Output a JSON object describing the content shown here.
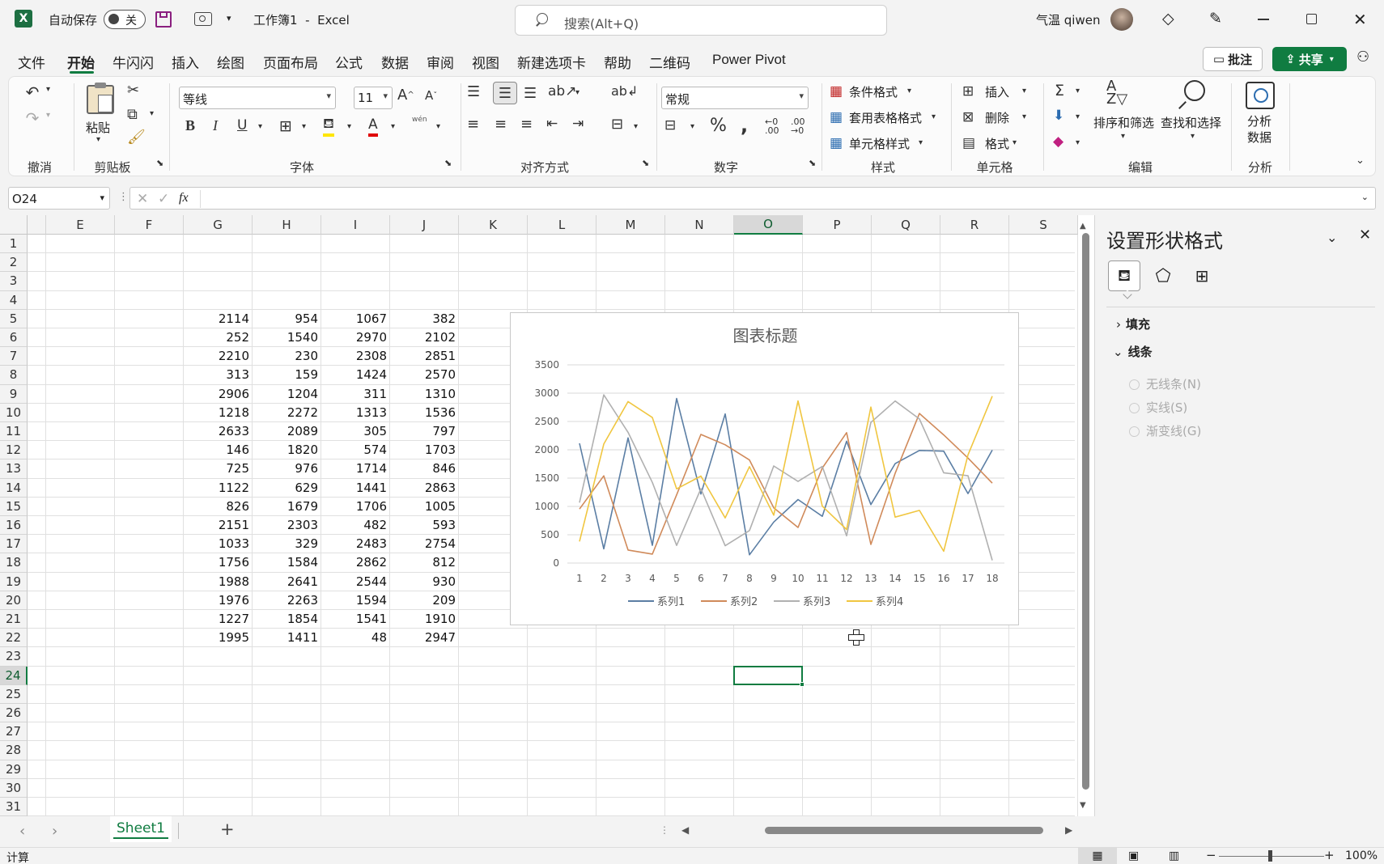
{
  "titlebar": {
    "app_icon": "excel-logo",
    "autosave_label": "自动保存",
    "autosave_state": "关",
    "doc_title": "工作簿1",
    "separator": "-",
    "app_name": "Excel",
    "search_placeholder": "搜索(Alt+Q)",
    "user_name": "气温 qiwen"
  },
  "menu": {
    "items": [
      "文件",
      "开始",
      "牛闪闪",
      "插入",
      "绘图",
      "页面布局",
      "公式",
      "数据",
      "审阅",
      "视图",
      "新建选项卡",
      "帮助",
      "二维码",
      "Power Pivot"
    ],
    "active": "开始",
    "comment_button": "批注",
    "share_button": "共享"
  },
  "ribbon": {
    "groups": [
      "撤消",
      "剪贴板",
      "字体",
      "对齐方式",
      "数字",
      "样式",
      "单元格",
      "编辑",
      "分析"
    ],
    "paste_label": "粘贴",
    "font_name": "等线",
    "font_size": "11",
    "number_format": "常规",
    "phonetic_label": "wén",
    "styles": [
      "条件格式",
      "套用表格格式",
      "单元格样式"
    ],
    "cells": [
      "插入",
      "删除",
      "格式"
    ],
    "sort_filter": "排序和筛选",
    "find_select": "查找和选择",
    "analyze_line1": "分析",
    "analyze_line2": "数据"
  },
  "formula_bar": {
    "name_box": "O24",
    "fx": "fx",
    "content": ""
  },
  "sheet": {
    "columns": [
      "E",
      "F",
      "G",
      "H",
      "I",
      "J",
      "K",
      "L",
      "M",
      "N",
      "O",
      "P",
      "Q",
      "R",
      "S"
    ],
    "active_column": "O",
    "rows": [
      "1",
      "2",
      "3",
      "4",
      "5",
      "6",
      "7",
      "8",
      "9",
      "10",
      "11",
      "12",
      "13",
      "14",
      "15",
      "16",
      "17",
      "18",
      "19",
      "20",
      "21",
      "22",
      "23",
      "24",
      "25",
      "26",
      "27",
      "28",
      "29",
      "30",
      "31"
    ],
    "active_row": "24",
    "data_start_row": 5,
    "data": [
      [
        "2114",
        "954",
        "1067",
        "382"
      ],
      [
        "252",
        "1540",
        "2970",
        "2102"
      ],
      [
        "2210",
        "230",
        "2308",
        "2851"
      ],
      [
        "313",
        "159",
        "1424",
        "2570"
      ],
      [
        "2906",
        "1204",
        "311",
        "1310"
      ],
      [
        "1218",
        "2272",
        "1313",
        "1536"
      ],
      [
        "2633",
        "2089",
        "305",
        "797"
      ],
      [
        "146",
        "1820",
        "574",
        "1703"
      ],
      [
        "725",
        "976",
        "1714",
        "846"
      ],
      [
        "1122",
        "629",
        "1441",
        "2863"
      ],
      [
        "826",
        "1679",
        "1706",
        "1005"
      ],
      [
        "2151",
        "2303",
        "482",
        "593"
      ],
      [
        "1033",
        "329",
        "2483",
        "2754"
      ],
      [
        "1756",
        "1584",
        "2862",
        "812"
      ],
      [
        "1988",
        "2641",
        "2544",
        "930"
      ],
      [
        "1976",
        "2263",
        "1594",
        "209"
      ],
      [
        "1227",
        "1854",
        "1541",
        "1910"
      ],
      [
        "1995",
        "1411",
        "48",
        "2947"
      ]
    ]
  },
  "chart_data": {
    "type": "line",
    "title": "图表标题",
    "x": [
      1,
      2,
      3,
      4,
      5,
      6,
      7,
      8,
      9,
      10,
      11,
      12,
      13,
      14,
      15,
      16,
      17,
      18
    ],
    "ylim": [
      0,
      3500
    ],
    "yticks": [
      0,
      500,
      1000,
      1500,
      2000,
      2500,
      3000,
      3500
    ],
    "grid": true,
    "legend": "bottom",
    "series": [
      {
        "name": "系列1",
        "color": "#5b7ea4",
        "values": [
          2114,
          252,
          2210,
          313,
          2906,
          1218,
          2633,
          146,
          725,
          1122,
          826,
          2151,
          1033,
          1756,
          1988,
          1976,
          1227,
          1995
        ]
      },
      {
        "name": "系列2",
        "color": "#d08a5a",
        "values": [
          954,
          1540,
          230,
          159,
          1204,
          2272,
          2089,
          1820,
          976,
          629,
          1679,
          2303,
          329,
          1584,
          2641,
          2263,
          1854,
          1411
        ]
      },
      {
        "name": "系列3",
        "color": "#b0b0b0",
        "values": [
          1067,
          2970,
          2308,
          1424,
          311,
          1313,
          305,
          574,
          1714,
          1441,
          1706,
          482,
          2483,
          2862,
          2544,
          1594,
          1541,
          48
        ]
      },
      {
        "name": "系列4",
        "color": "#f0c640",
        "values": [
          382,
          2102,
          2851,
          2570,
          1310,
          1536,
          797,
          1703,
          846,
          2863,
          1005,
          593,
          2754,
          812,
          930,
          209,
          1910,
          2947
        ]
      }
    ]
  },
  "format_pane": {
    "title": "设置形状格式",
    "fill_label": "填充",
    "line_label": "线条",
    "options": [
      "无线条(N)",
      "实线(S)",
      "渐变线(G)"
    ]
  },
  "tabs": {
    "sheet_name": "Sheet1",
    "add": "+"
  },
  "status": {
    "mode": "计算",
    "zoom": "100%"
  }
}
